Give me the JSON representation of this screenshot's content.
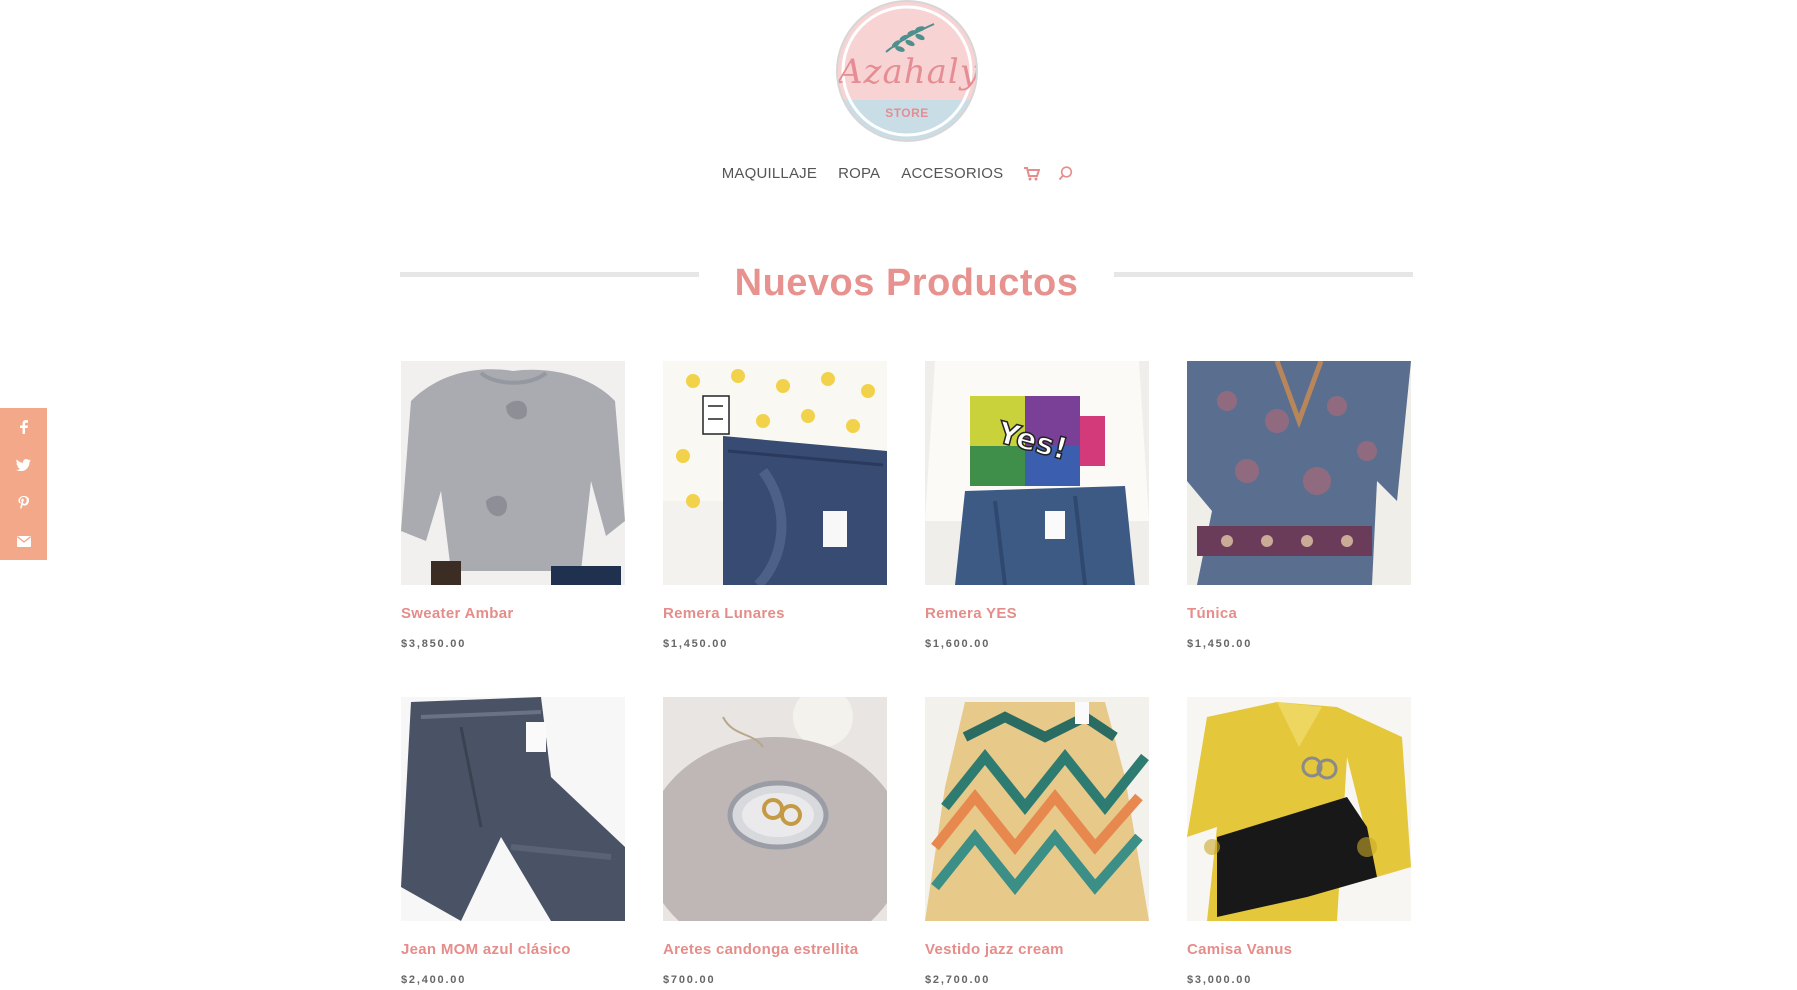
{
  "brand": {
    "logo_script": "Azahaly",
    "logo_store": "STORE"
  },
  "nav": {
    "items": [
      "MAQUILLAJE",
      "ROPA",
      "ACCESORIOS"
    ],
    "cart_icon": "cart-icon",
    "search_icon": "search-icon"
  },
  "section": {
    "title": "Nuevos Productos"
  },
  "social": [
    "facebook-icon",
    "twitter-icon",
    "pinterest-icon",
    "email-icon"
  ],
  "colors": {
    "accent": "#e8928f",
    "social_bg": "#f4a88a"
  },
  "products": [
    {
      "name": "Sweater Ambar",
      "price": "$3,850.00"
    },
    {
      "name": "Remera Lunares",
      "price": "$1,450.00"
    },
    {
      "name": "Remera YES",
      "price": "$1,600.00"
    },
    {
      "name": "Túnica",
      "price": "$1,450.00"
    },
    {
      "name": "Jean MOM azul clásico",
      "price": "$2,400.00"
    },
    {
      "name": "Aretes candonga estrellita",
      "price": "$700.00"
    },
    {
      "name": "Vestido jazz cream",
      "price": "$2,700.00"
    },
    {
      "name": "Camisa Vanus",
      "price": "$3,000.00"
    }
  ]
}
